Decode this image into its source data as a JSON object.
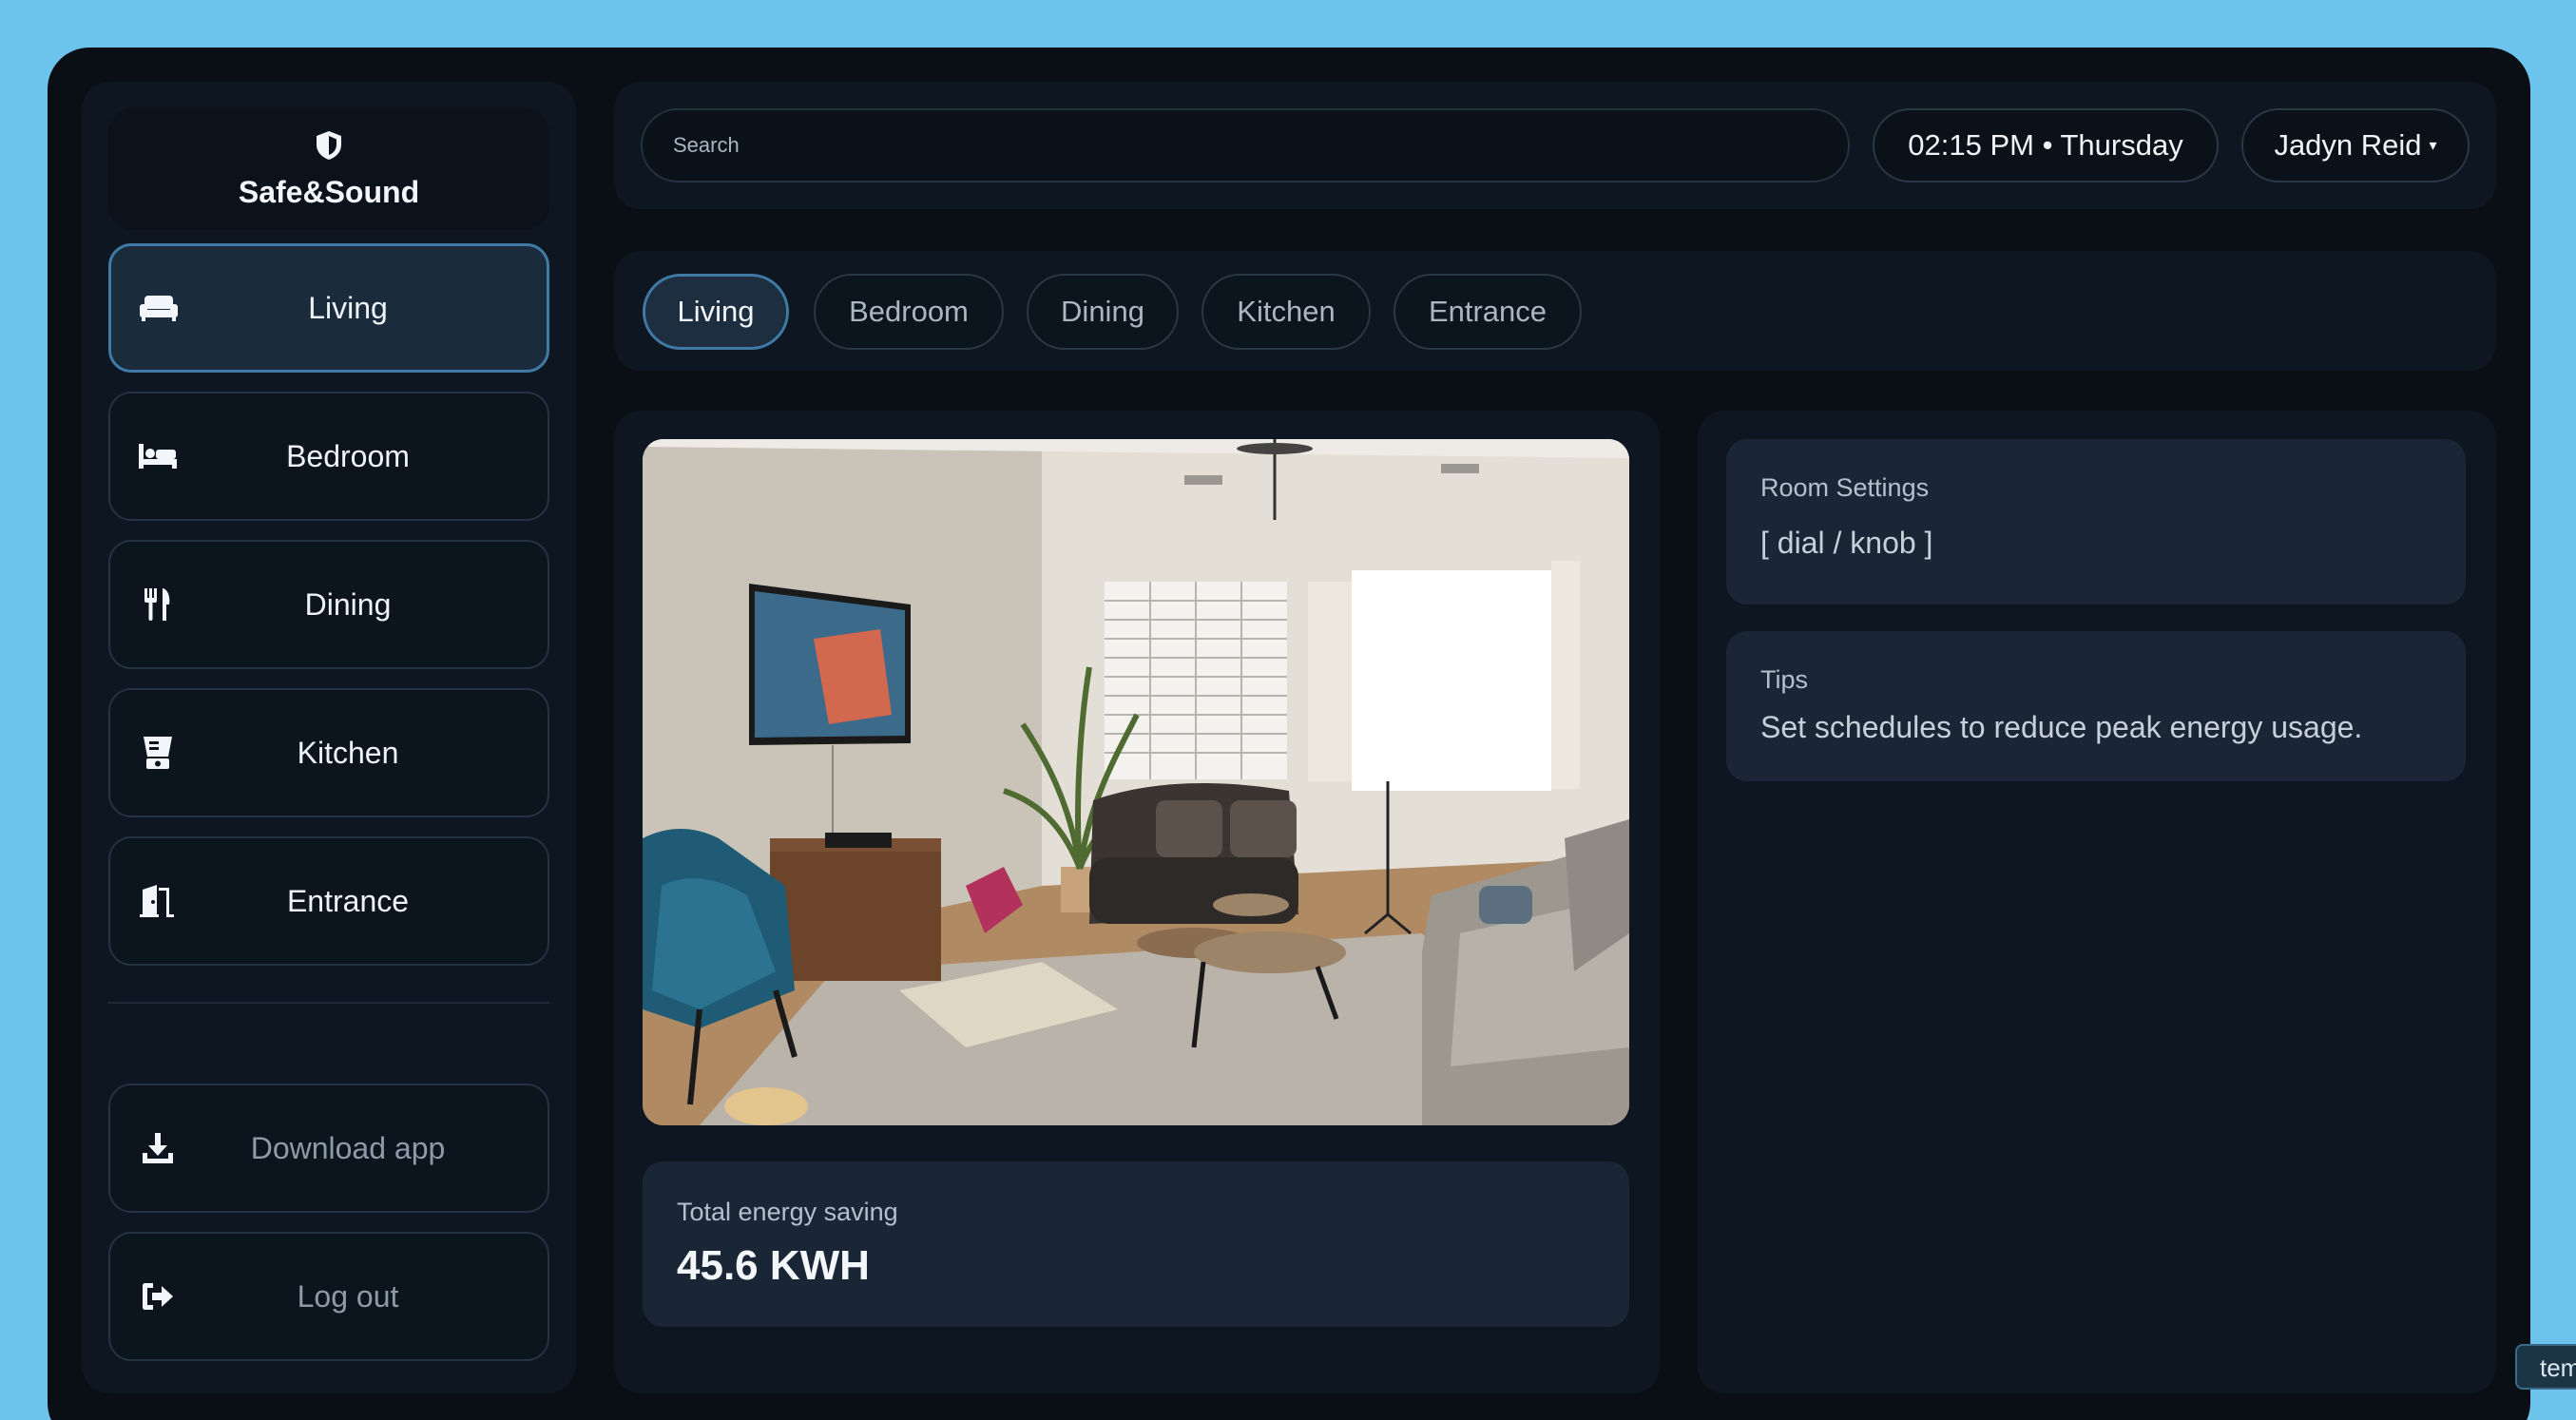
{
  "brand": {
    "name": "Safe&Sound",
    "icon": "shield-icon"
  },
  "sidebar": {
    "items": [
      {
        "label": "Living",
        "icon": "sofa-icon",
        "active": true
      },
      {
        "label": "Bedroom",
        "icon": "bed-icon",
        "active": false
      },
      {
        "label": "Dining",
        "icon": "utensils-icon",
        "active": false
      },
      {
        "label": "Kitchen",
        "icon": "blender-icon",
        "active": false
      },
      {
        "label": "Entrance",
        "icon": "door-icon",
        "active": false
      }
    ],
    "footer": [
      {
        "label": "Download app",
        "icon": "download-icon"
      },
      {
        "label": "Log out",
        "icon": "logout-icon"
      }
    ]
  },
  "header": {
    "search_placeholder": "Search",
    "time": "02:15 PM • Thursday",
    "user": "Jadyn Reid",
    "user_caret": "▾"
  },
  "tabs": [
    "Living",
    "Bedroom",
    "Dining",
    "Kitchen",
    "Entrance"
  ],
  "active_tab": "Living",
  "energy": {
    "label": "Total energy saving",
    "value": "45.6 KWH"
  },
  "room_settings": {
    "title": "Room Settings",
    "placeholder": "[ dial / knob ]"
  },
  "tips": {
    "title": "Tips",
    "text": "Set schedules to reduce peak energy usage."
  },
  "tooltip": {
    "text": "tem"
  },
  "colors": {
    "accent": "#3f7aa5",
    "background": "#6cc3ec",
    "panel": "#0e1621"
  }
}
